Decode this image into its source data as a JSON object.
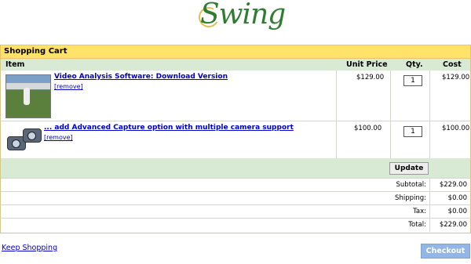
{
  "logo": {
    "text": "Swing"
  },
  "cart": {
    "title": "Shopping Cart",
    "columns": {
      "item": "Item",
      "unit_price": "Unit Price",
      "qty": "Qty.",
      "cost": "Cost"
    },
    "items": [
      {
        "name": "Video Analysis Software: Download Version",
        "remove": "[remove]",
        "unit_price": "$129.00",
        "qty": "1",
        "cost": "$129.00"
      },
      {
        "name": "... add Advanced Capture option with multiple camera support",
        "remove": "[remove]",
        "unit_price": "$100.00",
        "qty": "1",
        "cost": "$100.00"
      }
    ],
    "update_label": "Update",
    "totals": {
      "subtotal_label": "Subtotal:",
      "subtotal": "$229.00",
      "shipping_label": "Shipping:",
      "shipping": "$0.00",
      "tax_label": "Tax:",
      "tax": "$0.00",
      "total_label": "Total:",
      "total": "$229.00"
    }
  },
  "footer": {
    "keep_shopping": "Keep Shopping",
    "checkout": "Checkout"
  }
}
